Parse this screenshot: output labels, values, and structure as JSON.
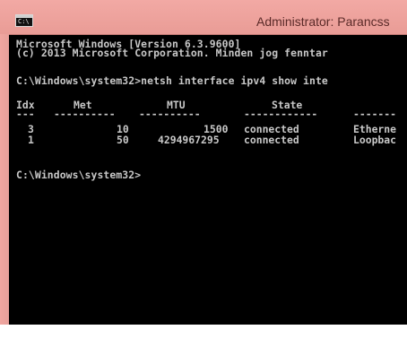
{
  "window": {
    "title": "Administrator: Parancss"
  },
  "console": {
    "version_line": "Microsoft Windows [Version 6.3.9600]",
    "copyright_line": "(c) 2013 Microsoft Corporation. Minden jog fenntar",
    "command_line": "C:\\Windows\\system32>netsh interface ipv4 show inte",
    "prompt_line": "C:\\Windows\\system32>"
  },
  "table": {
    "headers": [
      "Idx",
      "Met",
      "MTU",
      "State",
      ""
    ],
    "separators": [
      "---",
      "----------",
      "----------",
      "------------",
      "-------"
    ],
    "rows": [
      {
        "idx": "3",
        "met": "10",
        "mtu": "1500",
        "state": "connected",
        "name": "Etherne"
      },
      {
        "idx": "1",
        "met": "50",
        "mtu": "4294967295",
        "state": "connected",
        "name": "Loopbac"
      }
    ]
  }
}
